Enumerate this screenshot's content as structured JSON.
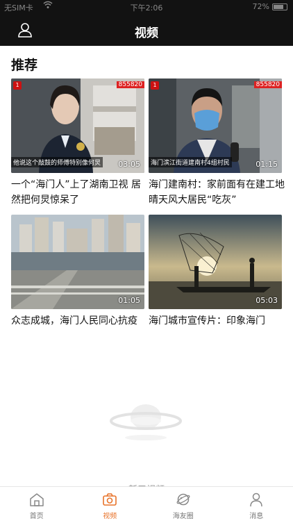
{
  "status_bar": {
    "carrier": "无SIM卡",
    "time": "下午2:06",
    "battery": "72%"
  },
  "header": {
    "title": "视频",
    "user_icon": "user-icon"
  },
  "section": {
    "title": "推荐"
  },
  "videos": [
    {
      "title": "一个“海门人”上了湖南卫视 居然把何炅惊呆了",
      "duration": "03:05",
      "overlay_caption": "他说这个敲鼓的师傅特别像何炅",
      "channel_badge": "855820"
    },
    {
      "title": "海门建南村：家前面有在建工地 晴天风大居民“吃灰”",
      "duration": "01:15",
      "overlay_caption": "海门滨江街道建南村4组村民",
      "channel_badge": "855820"
    },
    {
      "title": "众志成城，海门人民同心抗疫",
      "duration": "01:05"
    },
    {
      "title": "海门城市宣传片：印象海门",
      "duration": "05:03"
    }
  ],
  "footer_more": "新三视频",
  "tabbar": {
    "tabs": [
      {
        "label": "首页",
        "icon": "home-icon",
        "active": false
      },
      {
        "label": "视频",
        "icon": "video-camera-icon",
        "active": true
      },
      {
        "label": "海友圈",
        "icon": "planet-icon",
        "active": false
      },
      {
        "label": "消息",
        "icon": "message-user-icon",
        "active": false
      }
    ]
  },
  "colors": {
    "header_bg": "#121212",
    "accent": "#e8732a"
  }
}
